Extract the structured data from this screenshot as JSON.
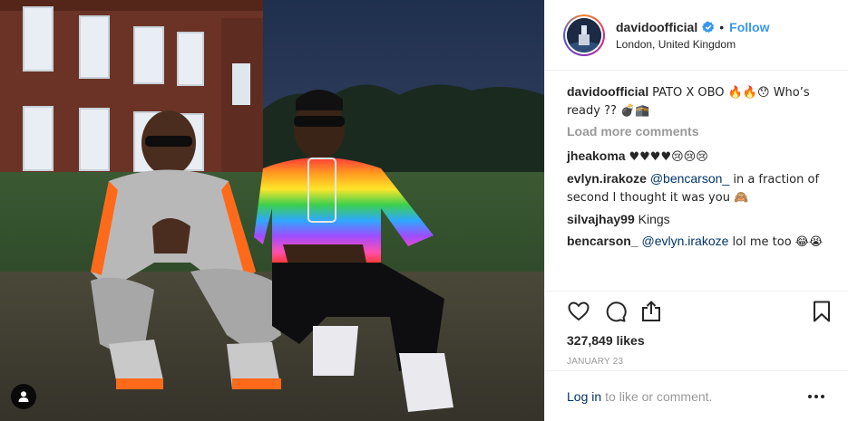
{
  "post": {
    "username": "davidoofficial",
    "follow_label": "Follow",
    "separator": "•",
    "location": "London, United Kingdom",
    "caption": {
      "author": "davidoofficial",
      "text": "PATO X OBO 🔥🔥😯 Who’s ready ?? 💣🕋"
    },
    "load_more_label": "Load more comments",
    "comments": [
      {
        "author": "jheakoma",
        "text": "♥♥♥♥😢😢😢",
        "mention": ""
      },
      {
        "author": "evlyn.irakoze",
        "mention": "@bencarson_",
        "text": " in a fraction of second I thought it was you 🙈"
      },
      {
        "author": "silvajhay99",
        "text": "Kings",
        "mention": ""
      },
      {
        "author": "bencarson_",
        "mention": "@evlyn.irakoze",
        "text": " lol me too 😂😭"
      }
    ],
    "likes_label": "327,849 likes",
    "date_label": "JANUARY 23",
    "login_link": "Log in",
    "login_text": "to like or comment."
  },
  "colors": {
    "link_blue": "#3897f0",
    "mention_blue": "#003569",
    "muted": "#999999",
    "text": "#262626"
  },
  "icons": {
    "like": "heart-icon",
    "comment": "comment-icon",
    "share": "share-icon",
    "save": "bookmark-icon",
    "more": "more-options-icon",
    "verified": "verified-badge-icon",
    "tag": "user-tag-icon"
  }
}
